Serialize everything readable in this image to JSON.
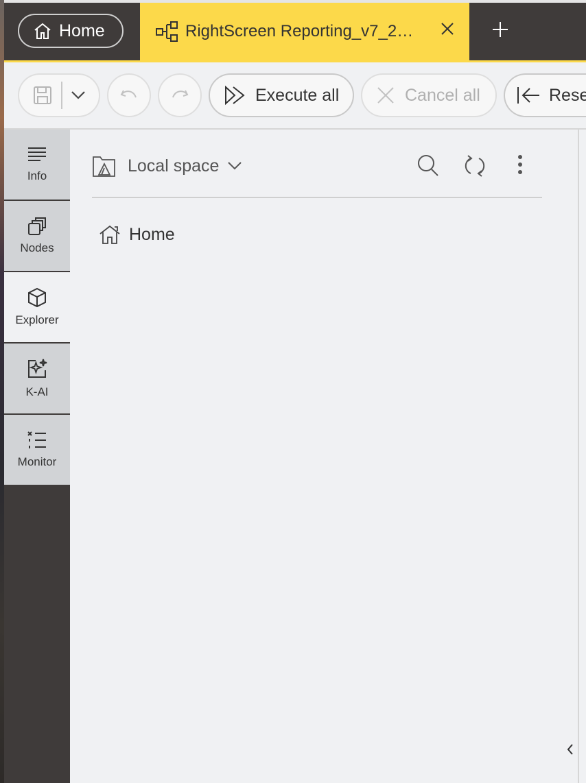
{
  "tabs": {
    "home_label": "Home",
    "active_label": "RightScreen Reporting_v7_2…",
    "new_tab": "+"
  },
  "toolbar": {
    "execute_all": "Execute all",
    "cancel_all": "Cancel all",
    "reset": "Rese"
  },
  "sidebar": {
    "items": [
      {
        "label": "Info",
        "icon": "info-lines-icon"
      },
      {
        "label": "Nodes",
        "icon": "nodes-icon"
      },
      {
        "label": "Explorer",
        "icon": "cube-icon",
        "active": true
      },
      {
        "label": "K-AI",
        "icon": "sparkle-icon"
      },
      {
        "label": "Monitor",
        "icon": "monitor-list-icon"
      }
    ]
  },
  "explorer": {
    "space": "Local space",
    "home": "Home"
  },
  "colors": {
    "accent": "#fcd94a",
    "dark": "#3f3b3a",
    "panel": "#f0f1f3"
  }
}
